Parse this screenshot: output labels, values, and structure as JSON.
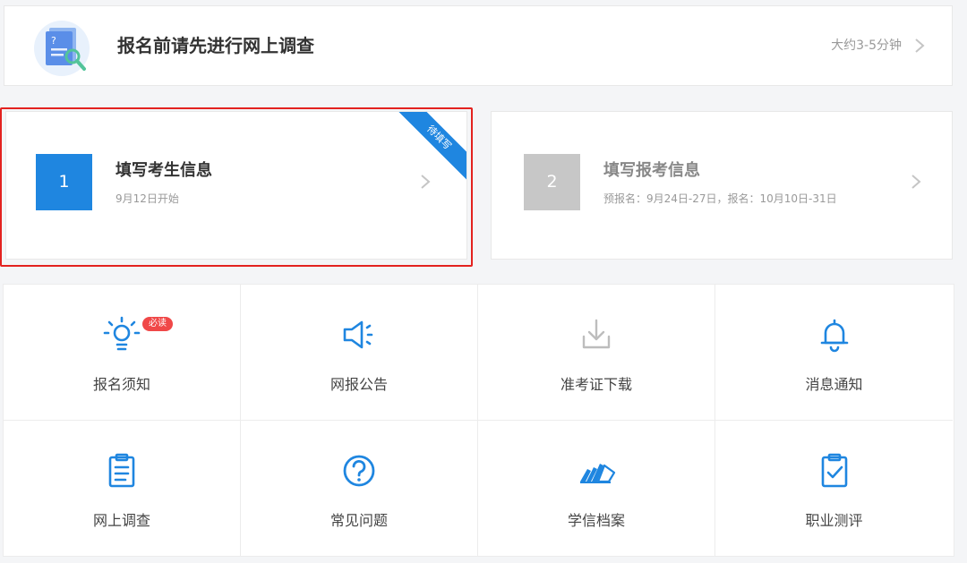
{
  "survey": {
    "title": "报名前请先进行网上调查",
    "duration": "大约3-5分钟"
  },
  "steps": [
    {
      "number": "1",
      "title": "填写考生信息",
      "subtitle": "9月12日开始",
      "ribbon": "待填写",
      "status": "active"
    },
    {
      "number": "2",
      "title": "填写报考信息",
      "subtitle": "预报名：9月24日-27日，报名：10月10日-31日",
      "status": "disabled"
    }
  ],
  "grid": {
    "badge": "必读",
    "items": [
      {
        "label": "报名须知",
        "icon": "lightbulb-icon"
      },
      {
        "label": "网报公告",
        "icon": "megaphone-icon"
      },
      {
        "label": "准考证下载",
        "icon": "download-icon"
      },
      {
        "label": "消息通知",
        "icon": "bell-icon"
      },
      {
        "label": "网上调查",
        "icon": "clipboard-icon"
      },
      {
        "label": "常见问题",
        "icon": "question-circle-icon"
      },
      {
        "label": "学信档案",
        "icon": "archive-icon"
      },
      {
        "label": "职业测评",
        "icon": "checklist-icon"
      }
    ]
  },
  "colors": {
    "accent": "#1f86e0",
    "highlight": "#e3221f",
    "badge": "#f04848",
    "disabled": "#c7c7c7"
  }
}
